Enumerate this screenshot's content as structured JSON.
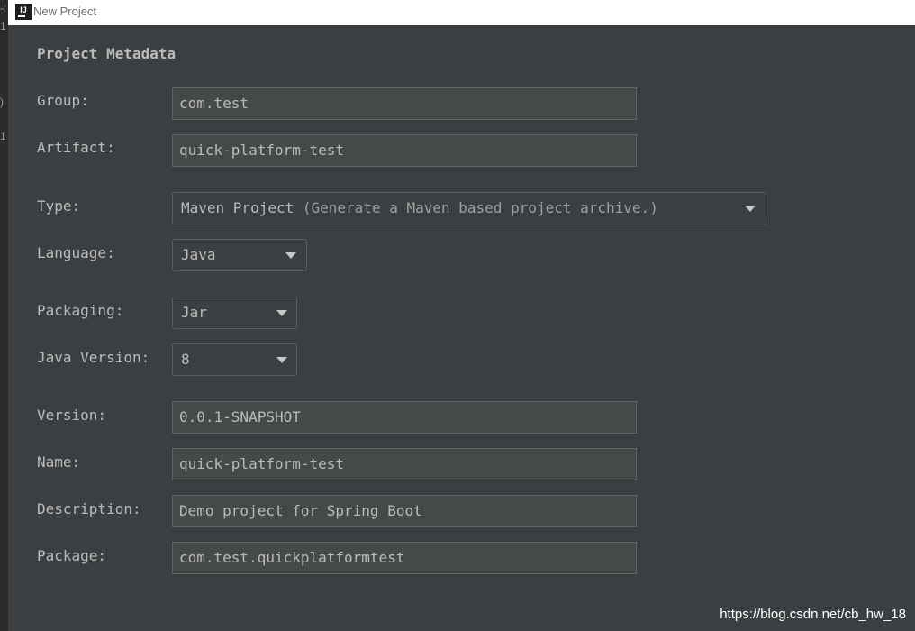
{
  "window": {
    "title": "New Project"
  },
  "section_title": "Project Metadata",
  "group": {
    "label": "Group:",
    "value": "com.test"
  },
  "artifact": {
    "label": "Artifact:",
    "value": "quick-platform-test"
  },
  "type": {
    "label": "Type:",
    "value": "Maven Project",
    "hint": "(Generate a Maven based project archive.)"
  },
  "language": {
    "label": "Language:",
    "value": "Java"
  },
  "packaging": {
    "label": "Packaging:",
    "value": "Jar"
  },
  "java_version": {
    "label": "Java Version:",
    "value": "8"
  },
  "version": {
    "label": "Version:",
    "value": "0.0.1-SNAPSHOT"
  },
  "name": {
    "label": "Name:",
    "value": "quick-platform-test"
  },
  "description": {
    "label": "Description:",
    "value": "Demo project for Spring Boot"
  },
  "package": {
    "label": "Package:",
    "value": "com.test.quickplatformtest"
  },
  "watermark": "https://blog.csdn.net/cb_hw_18",
  "colors": {
    "background": "#3c3f41",
    "field": "#45494a",
    "text": "#bbbbbb",
    "titlebar": "#ffffff"
  }
}
